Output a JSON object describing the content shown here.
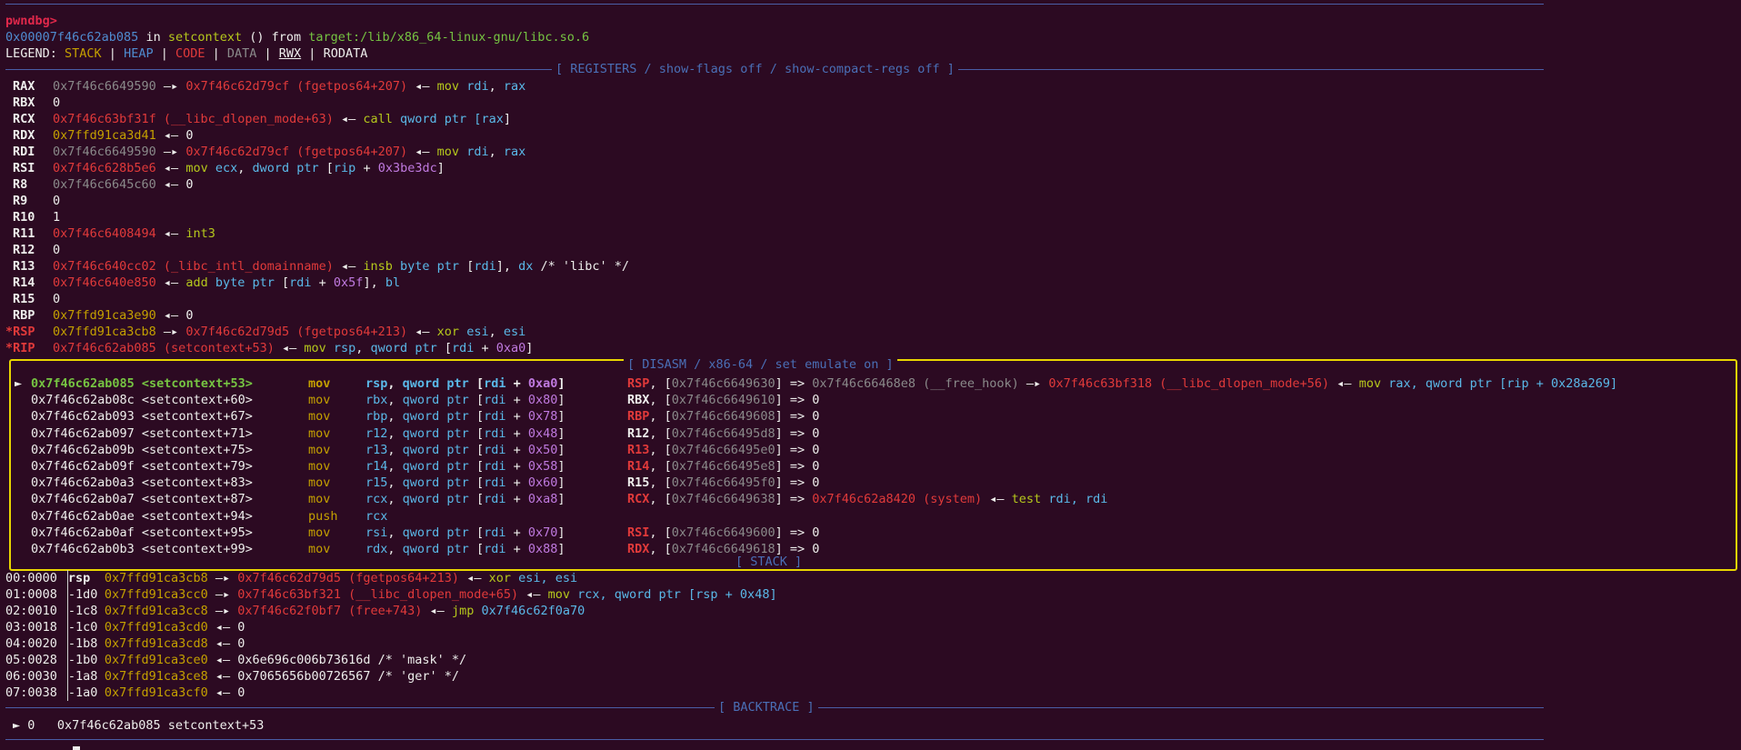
{
  "prompt": "pwndbg>",
  "location": {
    "addr": "0x00007f46c62ab085",
    "in": " in ",
    "func": "setcontext",
    "args": " () from ",
    "lib": "target:/lib/x86_64-linux-gnu/libc.so.6"
  },
  "legend": {
    "prefix": "LEGEND: ",
    "stack": "STACK",
    "heap": "HEAP",
    "code": "CODE",
    "data": "DATA",
    "rwx": "RWX",
    "rodata": "RODATA",
    "sep": " | "
  },
  "sections": {
    "registers": "[ REGISTERS / show-flags off / show-compact-regs off ]",
    "disasm": "[ DISASM / x86-64 / set emulate on ]",
    "stack": "[ STACK ]",
    "backtrace": "[ BACKTRACE ]"
  },
  "registers": [
    {
      "name": "RAX",
      "v1": "0x7f46c6649590",
      "a1": " —▸ ",
      "v2": "0x7f46c62d79cf (fgetpos64+207)",
      "a2": " ◂— ",
      "ins": "mov",
      "ops": [
        {
          "t": "rdi",
          "c": "cyan"
        },
        {
          "t": ", ",
          "c": ""
        },
        {
          "t": "rax",
          "c": "cyan"
        }
      ]
    },
    {
      "name": "RBX",
      "plain": "0"
    },
    {
      "name": "RCX",
      "v1": "0x7f46c63bf31f (__libc_dlopen_mode+63)",
      "a2": " ◂— ",
      "ins": "call",
      "ops": [
        {
          "t": "qword ptr [",
          "c": "cyan"
        },
        {
          "t": "rax",
          "c": "cyan"
        },
        {
          "t": "]",
          "c": ""
        }
      ]
    },
    {
      "name": "RDX",
      "v1": "0x7ffd91ca3d41",
      "a2": " ◂— ",
      "tail": "0"
    },
    {
      "name": "RDI",
      "v1": "0x7f46c6649590",
      "a1": " —▸ ",
      "v2": "0x7f46c62d79cf (fgetpos64+207)",
      "a2": " ◂— ",
      "ins": "mov",
      "ops": [
        {
          "t": "rdi",
          "c": "cyan"
        },
        {
          "t": ", ",
          "c": ""
        },
        {
          "t": "rax",
          "c": "cyan"
        }
      ]
    },
    {
      "name": "RSI",
      "v1": "0x7f46c628b5e6",
      "a2": " ◂— ",
      "ins": "mov",
      "ops": [
        {
          "t": "ecx",
          "c": "cyan"
        },
        {
          "t": ", ",
          "c": ""
        },
        {
          "t": "dword ptr",
          "c": "cyan"
        },
        {
          "t": " [",
          "c": ""
        },
        {
          "t": "rip",
          "c": "cyan"
        },
        {
          "t": " + ",
          "c": ""
        },
        {
          "t": "0x3be3dc",
          "c": "mag"
        },
        {
          "t": "]",
          "c": ""
        }
      ]
    },
    {
      "name": "R8",
      "v1": "0x7f46c6645c60",
      "a2": " ◂— ",
      "tail": "0"
    },
    {
      "name": "R9",
      "plain": "0"
    },
    {
      "name": "R10",
      "plain": "1"
    },
    {
      "name": "R11",
      "v1": "0x7f46c6408494",
      "a2": " ◂— ",
      "ins": "int3",
      "ops": []
    },
    {
      "name": "R12",
      "plain": "0"
    },
    {
      "name": "R13",
      "v1": "0x7f46c640cc02 (_libc_intl_domainname)",
      "a2": " ◂— ",
      "ins": "insb",
      "ops": [
        {
          "t": "byte ptr",
          "c": "cyan"
        },
        {
          "t": " [",
          "c": ""
        },
        {
          "t": "rdi",
          "c": "cyan"
        },
        {
          "t": "], ",
          "c": ""
        },
        {
          "t": "dx",
          "c": "cyan"
        },
        {
          "t": " /* 'libc' */",
          "c": ""
        }
      ]
    },
    {
      "name": "R14",
      "v1": "0x7f46c640e850",
      "a2": " ◂— ",
      "ins": "add",
      "ops": [
        {
          "t": "byte ptr",
          "c": "cyan"
        },
        {
          "t": " [",
          "c": ""
        },
        {
          "t": "rdi",
          "c": "cyan"
        },
        {
          "t": " + ",
          "c": ""
        },
        {
          "t": "0x5f",
          "c": "mag"
        },
        {
          "t": "], ",
          "c": ""
        },
        {
          "t": "bl",
          "c": "cyan"
        }
      ]
    },
    {
      "name": "R15",
      "plain": "0"
    },
    {
      "name": "RBP",
      "v1": "0x7ffd91ca3e90",
      "a2": " ◂— ",
      "tail": "0"
    },
    {
      "name": "*RSP",
      "v1": "0x7ffd91ca3cb8",
      "a1": " —▸ ",
      "v2": "0x7f46c62d79d5 (fgetpos64+213)",
      "a2": " ◂— ",
      "ins": "xor",
      "ops": [
        {
          "t": "esi",
          "c": "cyan"
        },
        {
          "t": ", ",
          "c": ""
        },
        {
          "t": "esi",
          "c": "cyan"
        }
      ]
    },
    {
      "name": "*RIP",
      "v1": "0x7f46c62ab085 (setcontext+53)",
      "a2": " ◂— ",
      "ins": "mov",
      "ops": [
        {
          "t": "rsp",
          "c": "cyan"
        },
        {
          "t": ", ",
          "c": ""
        },
        {
          "t": "qword ptr",
          "c": "cyan"
        },
        {
          "t": " [",
          "c": ""
        },
        {
          "t": "rdi",
          "c": "cyan"
        },
        {
          "t": " + ",
          "c": ""
        },
        {
          "t": "0xa0",
          "c": "mag"
        },
        {
          "t": "]",
          "c": ""
        }
      ]
    }
  ],
  "disasm": [
    {
      "cur": true,
      "addr": "0x7f46c62ab085 <setcontext+53>",
      "mn": "mov",
      "r": "rsp",
      "m": "qword ptr",
      "base": "rdi",
      "off": "0xa0",
      "ereg": "RSP",
      "ep": "0x7f46c6649630",
      "ev": "0x7f46c66468e8 (__free_hook)",
      "ev2": "0x7f46c63bf318 (__libc_dlopen_mode+56)",
      "eins": "mov",
      "eops": "rax, qword ptr [rip + 0x28a269]"
    },
    {
      "addr": "0x7f46c62ab08c <setcontext+60>",
      "mn": "mov",
      "r": "rbx",
      "m": "qword ptr",
      "base": "rdi",
      "off": "0x80",
      "ereg": "RBX",
      "ep": "0x7f46c6649610",
      "eplain": "0"
    },
    {
      "addr": "0x7f46c62ab093 <setcontext+67>",
      "mn": "mov",
      "r": "rbp",
      "m": "qword ptr",
      "base": "rdi",
      "off": "0x78",
      "ereg": "RBP",
      "ep": "0x7f46c6649608",
      "eplain": "0",
      "red": true
    },
    {
      "addr": "0x7f46c62ab097 <setcontext+71>",
      "mn": "mov",
      "r": "r12",
      "m": "qword ptr",
      "base": "rdi",
      "off": "0x48",
      "ereg": "R12",
      "ep": "0x7f46c66495d8",
      "eplain": "0"
    },
    {
      "addr": "0x7f46c62ab09b <setcontext+75>",
      "mn": "mov",
      "r": "r13",
      "m": "qword ptr",
      "base": "rdi",
      "off": "0x50",
      "ereg": "R13",
      "ep": "0x7f46c66495e0",
      "eplain": "0",
      "red": true
    },
    {
      "addr": "0x7f46c62ab09f <setcontext+79>",
      "mn": "mov",
      "r": "r14",
      "m": "qword ptr",
      "base": "rdi",
      "off": "0x58",
      "ereg": "R14",
      "ep": "0x7f46c66495e8",
      "eplain": "0",
      "red": true
    },
    {
      "addr": "0x7f46c62ab0a3 <setcontext+83>",
      "mn": "mov",
      "r": "r15",
      "m": "qword ptr",
      "base": "rdi",
      "off": "0x60",
      "ereg": "R15",
      "ep": "0x7f46c66495f0",
      "eplain": "0"
    },
    {
      "addr": "0x7f46c62ab0a7 <setcontext+87>",
      "mn": "mov",
      "r": "rcx",
      "m": "qword ptr",
      "base": "rdi",
      "off": "0xa8",
      "ereg": "RCX",
      "ep": "0x7f46c6649638",
      "ev": "0x7f46c62a8420 (system)",
      "eins": "test",
      "eops": "rdi, rdi",
      "red": true
    },
    {
      "addr": "0x7f46c62ab0ae <setcontext+94>",
      "mn": "push",
      "r": "rcx"
    },
    {
      "addr": "0x7f46c62ab0af <setcontext+95>",
      "mn": "mov",
      "r": "rsi",
      "m": "qword ptr",
      "base": "rdi",
      "off": "0x70",
      "ereg": "RSI",
      "ep": "0x7f46c6649600",
      "eplain": "0",
      "red": true
    },
    {
      "addr": "0x7f46c62ab0b3 <setcontext+99>",
      "mn": "mov",
      "r": "rdx",
      "m": "qword ptr",
      "base": "rdi",
      "off": "0x88",
      "ereg": "RDX",
      "ep": "0x7f46c6649618",
      "eplain": "0",
      "red": true
    }
  ],
  "stack": [
    {
      "idx": "00:0000",
      "off": "rsp",
      "ptr": "0x7ffd91ca3cb8",
      "a1": " —▸ ",
      "v": "0x7f46c62d79d5 (fgetpos64+213)",
      "a2": " ◂— ",
      "ins": "xor",
      "ops": "esi, esi"
    },
    {
      "idx": "01:0008",
      "off": "-1d0",
      "ptr": "0x7ffd91ca3cc0",
      "a1": " —▸ ",
      "v": "0x7f46c63bf321 (__libc_dlopen_mode+65)",
      "a2": " ◂— ",
      "ins": "mov",
      "ops": "rcx, qword ptr [rsp + 0x48]"
    },
    {
      "idx": "02:0010",
      "off": "-1c8",
      "ptr": "0x7ffd91ca3cc8",
      "a1": " —▸ ",
      "v": "0x7f46c62f0bf7 (free+743)",
      "a2": " ◂— ",
      "ins": "jmp",
      "ops": "0x7f46c62f0a70"
    },
    {
      "idx": "03:0018",
      "off": "-1c0",
      "ptr": "0x7ffd91ca3cd0",
      "a2": " ◂— ",
      "tail": "0"
    },
    {
      "idx": "04:0020",
      "off": "-1b8",
      "ptr": "0x7ffd91ca3cd8",
      "a2": " ◂— ",
      "tail": "0"
    },
    {
      "idx": "05:0028",
      "off": "-1b0",
      "ptr": "0x7ffd91ca3ce0",
      "a2": " ◂— ",
      "tail": "0x6e696c006b73616d /* 'mask' */"
    },
    {
      "idx": "06:0030",
      "off": "-1a8",
      "ptr": "0x7ffd91ca3ce8",
      "a2": " ◂— ",
      "tail": "0x7065656b00726567 /* 'ger' */"
    },
    {
      "idx": "07:0038",
      "off": "-1a0",
      "ptr": "0x7ffd91ca3cf0",
      "a2": " ◂— ",
      "tail": "0"
    }
  ],
  "backtrace": {
    "marker": "►",
    "frame": "0",
    "addr": "0x7f46c62ab085",
    "sym": "setcontext+53"
  },
  "colors": {
    "bg": "#2c0a22",
    "stack": "#c4a000",
    "code": "#e13a3a",
    "data": "#8a8a8a",
    "heap": "#4f8cd0",
    "highlight": "#e8d600"
  }
}
